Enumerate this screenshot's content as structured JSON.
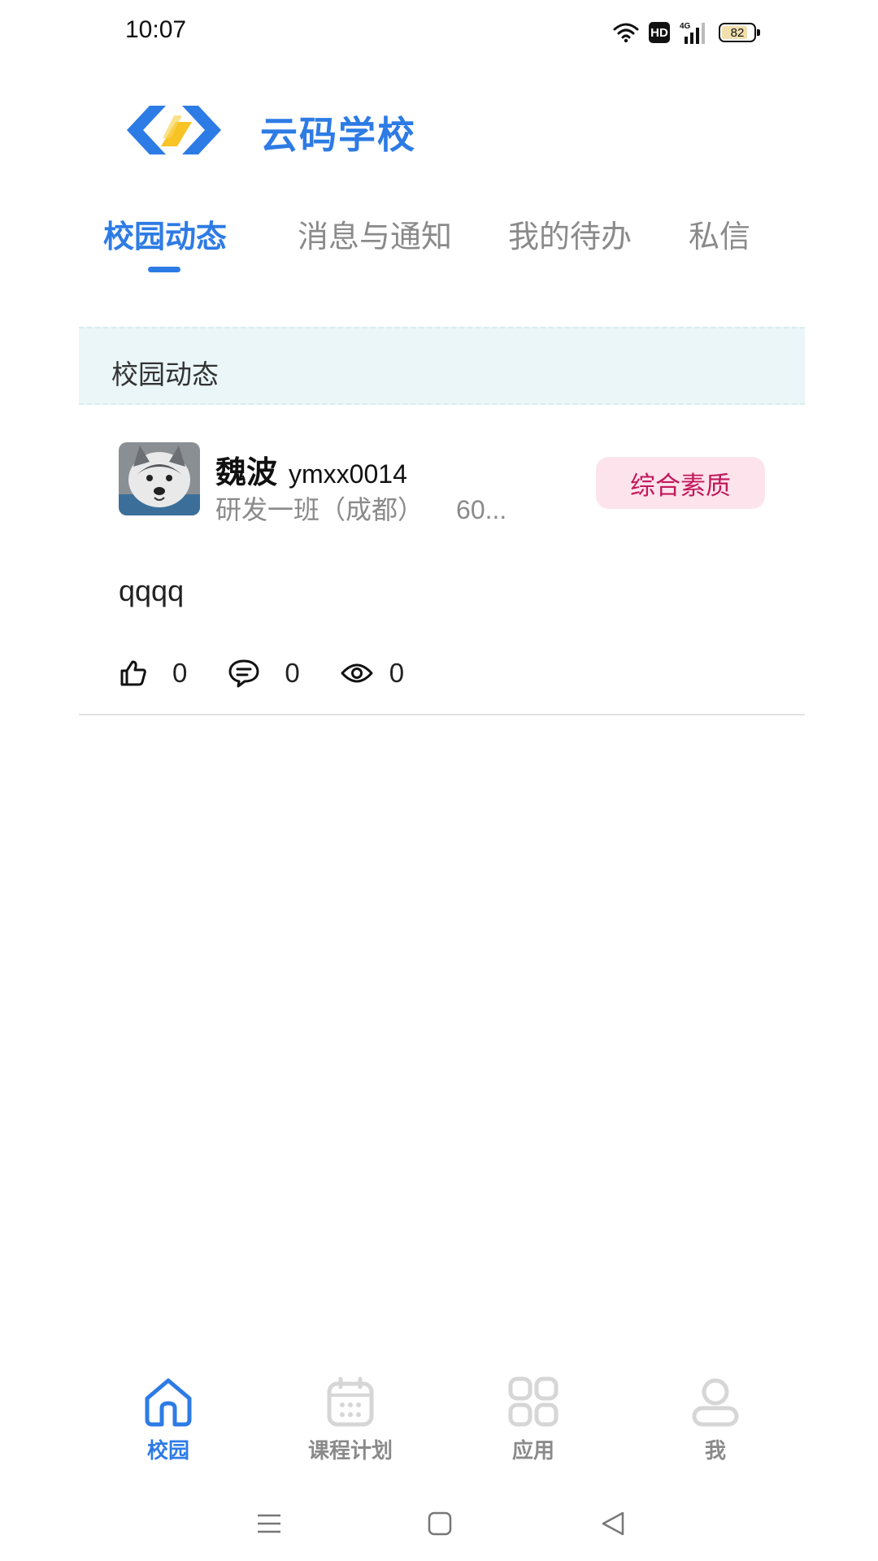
{
  "status_bar": {
    "time": "10:07",
    "network_label": "4G",
    "hd_label": "HD",
    "battery_level": "82",
    "battery_fraction": 0.82
  },
  "header": {
    "app_title": "云码学校",
    "logo_colors": {
      "primary": "#2d7be5",
      "accent": "#f7c325"
    }
  },
  "tabs": [
    {
      "label": "校园动态",
      "active": true
    },
    {
      "label": "消息与通知",
      "active": false
    },
    {
      "label": "我的待办",
      "active": false
    },
    {
      "label": "私信",
      "active": false
    }
  ],
  "section": {
    "title": "校园动态"
  },
  "post": {
    "author_name": "魏波",
    "author_id": "ymxx0014",
    "class_name": "研发一班（成都）",
    "time_truncated": "60...",
    "category_tag": "综合素质",
    "content": "qqqq",
    "likes": "0",
    "comments": "0",
    "views": "0"
  },
  "bottom_nav": [
    {
      "label": "校园",
      "icon": "home-icon",
      "active": true
    },
    {
      "label": "课程计划",
      "icon": "calendar-icon",
      "active": false
    },
    {
      "label": "应用",
      "icon": "apps-grid-icon",
      "active": false
    },
    {
      "label": "我",
      "icon": "user-icon",
      "active": false
    }
  ],
  "colors": {
    "accent": "#2d7be5",
    "muted_text": "#8a8a8a",
    "section_bg": "#eaf6f7",
    "tag_bg": "#fde3ec",
    "tag_text": "#c2185b",
    "inactive_icon": "#d6d6d6"
  }
}
